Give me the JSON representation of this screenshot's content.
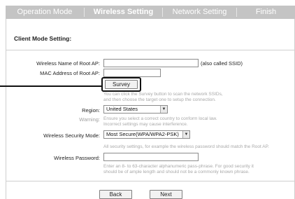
{
  "tabs": [
    {
      "label": "Operation Mode",
      "active": false
    },
    {
      "label": "Wireless Setting",
      "active": true
    },
    {
      "label": "Network Setting",
      "active": false
    },
    {
      "label": "Finish",
      "active": false
    }
  ],
  "section": {
    "title": "Client Mode Setting:"
  },
  "form": {
    "ssid_label": "Wireless Name of Root AP:",
    "ssid_value": "",
    "ssid_note": "(also called SSID)",
    "mac_label": "MAC Address of Root AP:",
    "mac_value": "",
    "survey_button": "Survey",
    "survey_hint_line1": "You can click the Survey button to scan the network SSIDs,",
    "survey_hint_line2": "and then choose the target one to setup the connection.",
    "region_label": "Region:",
    "region_value": "United States",
    "warning_label": "Warning:",
    "warning_line1": "Ensure you select a correct country to conform local law.",
    "warning_line2": "Incorrect settings may cause interference.",
    "security_label": "Wireless Security Mode:",
    "security_value": "Most Secure(WPA/WPA2-PSK)",
    "security_hint": "All security settings, for example the wireless password should match the Root AP.",
    "password_label": "Wireless Password:",
    "password_value": "",
    "password_hint_line1": "Enter an 8- to 63-character alphanumeric pass-phrase. For good security it",
    "password_hint_line2": "should be of ample length and should not be a commonly known phrase."
  },
  "footer": {
    "back_button": "Back",
    "next_button": "Next"
  },
  "colors": {
    "tab_bar": "#c4c4c4",
    "highlight": "#111111"
  }
}
